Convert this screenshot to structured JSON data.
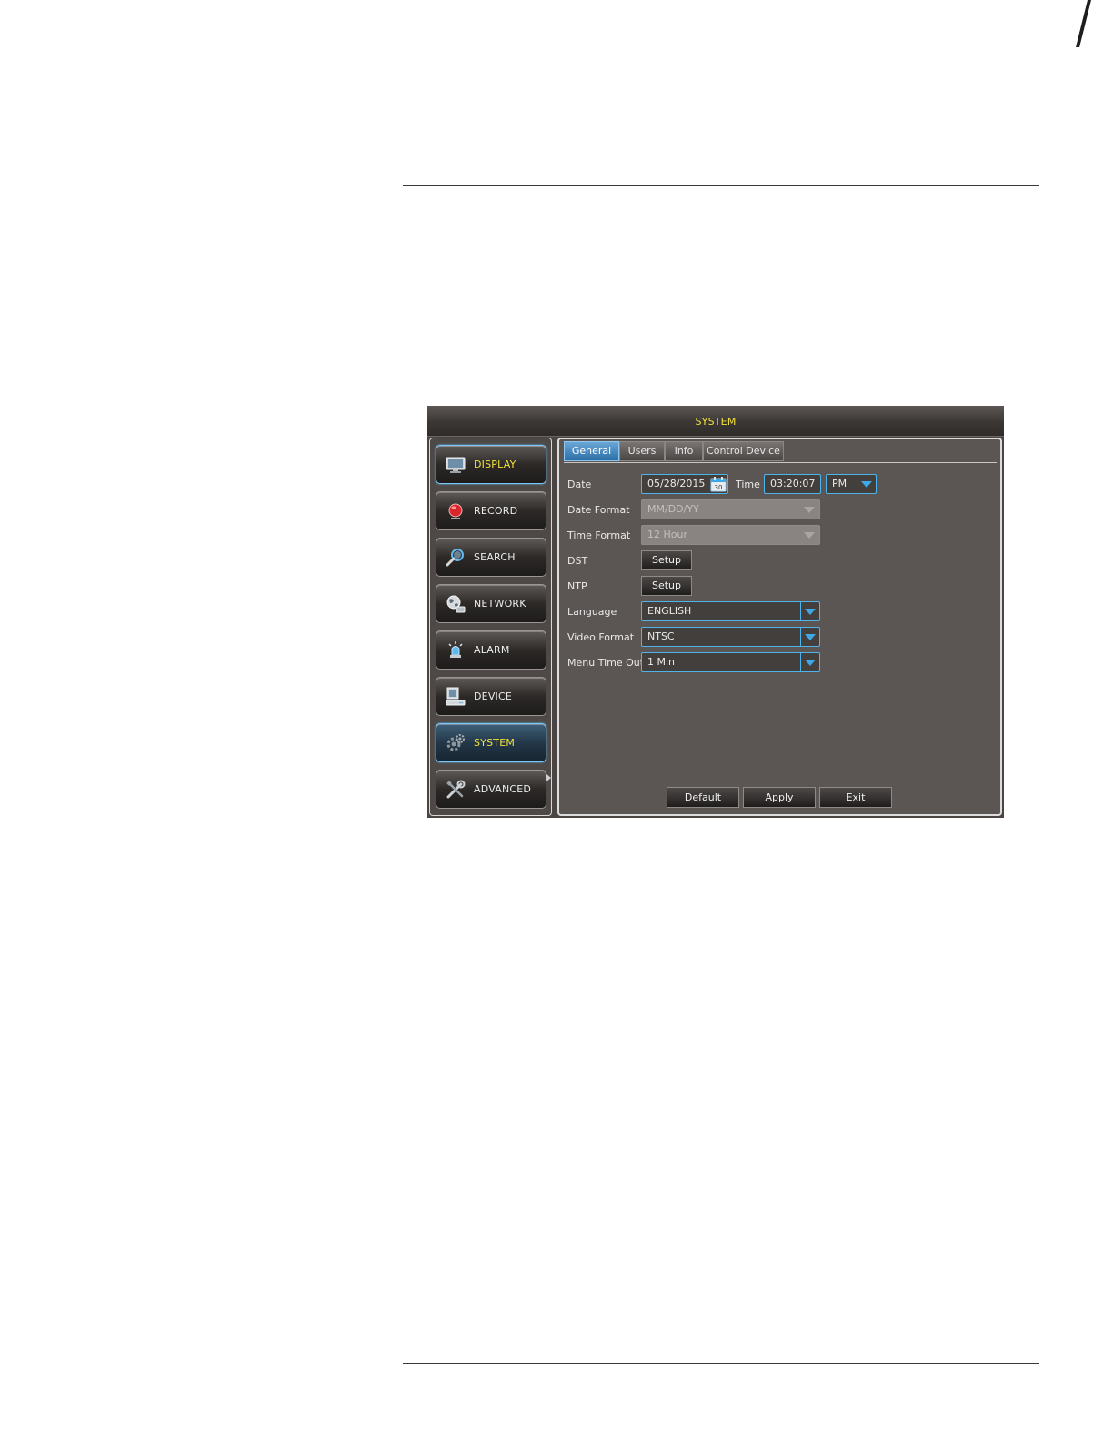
{
  "window": {
    "title": "SYSTEM"
  },
  "sidebar": {
    "items": [
      {
        "label": "DISPLAY",
        "icon": "monitor-icon"
      },
      {
        "label": "RECORD",
        "icon": "record-icon"
      },
      {
        "label": "SEARCH",
        "icon": "search-icon"
      },
      {
        "label": "NETWORK",
        "icon": "globe-icon"
      },
      {
        "label": "ALARM",
        "icon": "alarm-icon"
      },
      {
        "label": "DEVICE",
        "icon": "computer-icon"
      },
      {
        "label": "SYSTEM",
        "icon": "gear-icon"
      },
      {
        "label": "ADVANCED",
        "icon": "tools-icon"
      }
    ]
  },
  "tabs": [
    {
      "label": "General"
    },
    {
      "label": "Users"
    },
    {
      "label": "Info"
    },
    {
      "label": "Control Device"
    }
  ],
  "form": {
    "date_label": "Date",
    "date_value": "05/28/2015",
    "time_label": "Time",
    "time_value": "03:20:07",
    "ampm_value": "PM",
    "date_format_label": "Date Format",
    "date_format_value": "MM/DD/YY",
    "time_format_label": "Time Format",
    "time_format_value": "12 Hour",
    "dst_label": "DST",
    "ntp_label": "NTP",
    "setup_label": "Setup",
    "language_label": "Language",
    "language_value": "ENGLISH",
    "video_format_label": "Video Format",
    "video_format_value": "NTSC",
    "menu_timeout_label": "Menu Time Out",
    "menu_timeout_value": "1 Min"
  },
  "actions": {
    "default": "Default",
    "apply": "Apply",
    "exit": "Exit"
  },
  "colors": {
    "accent": "#3da9ea",
    "active_text": "#f2e23c",
    "panel_bg": "#5b5653"
  }
}
